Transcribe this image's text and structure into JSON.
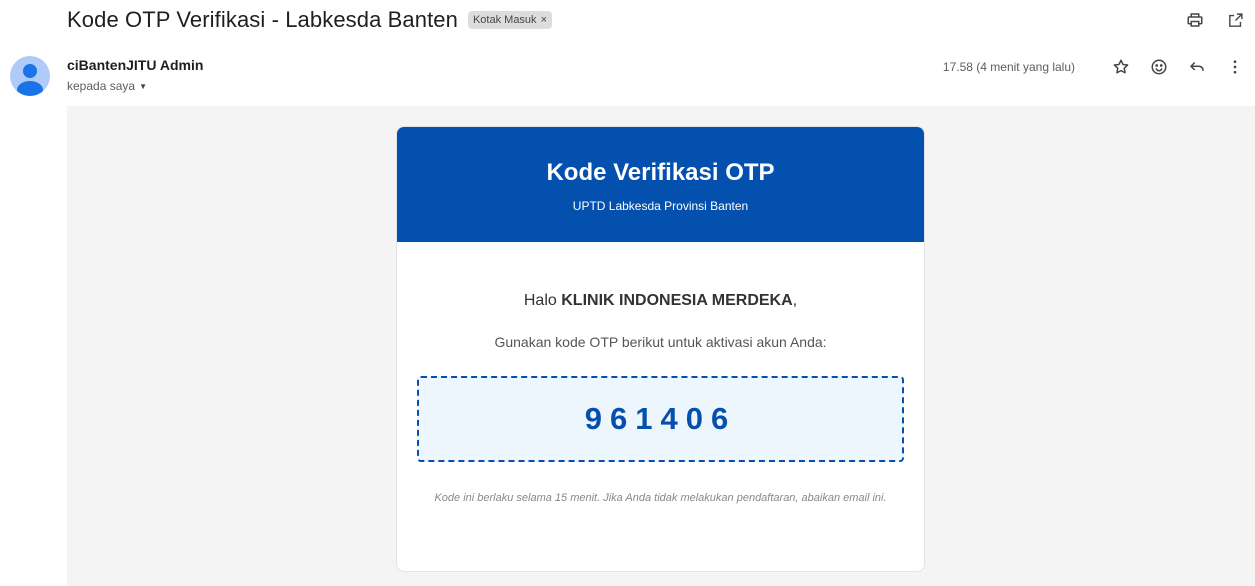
{
  "email": {
    "subject": "Kode OTP Verifikasi - Labkesda Banten",
    "label": "Kotak Masuk",
    "label_remove": "×",
    "sender_name": "ciBantenJITU Admin",
    "recipient": "kepada saya",
    "timestamp": "17.58 (4 menit yang lalu)"
  },
  "icons": {
    "print": "print-icon",
    "open_new": "open-in-new-window-icon",
    "star": "star-icon",
    "emoji": "emoji-reaction-icon",
    "reply": "reply-icon",
    "more": "more-vert-icon"
  },
  "card": {
    "title": "Kode Verifikasi OTP",
    "subtitle": "UPTD Labkesda Provinsi Banten",
    "greeting_prefix": "Halo ",
    "greeting_name": "KLINIK INDONESIA MERDEKA",
    "greeting_suffix": ",",
    "instruction": "Gunakan kode OTP berikut untuk aktivasi akun Anda:",
    "otp_code": "961406",
    "note": "Kode ini berlaku selama 15 menit. Jika Anda tidak melakukan pendaftaran, abaikan email ini."
  },
  "colors": {
    "header_blue": "#0450ae",
    "otp_background": "#eef6fd",
    "body_background": "#f4f4f4"
  }
}
